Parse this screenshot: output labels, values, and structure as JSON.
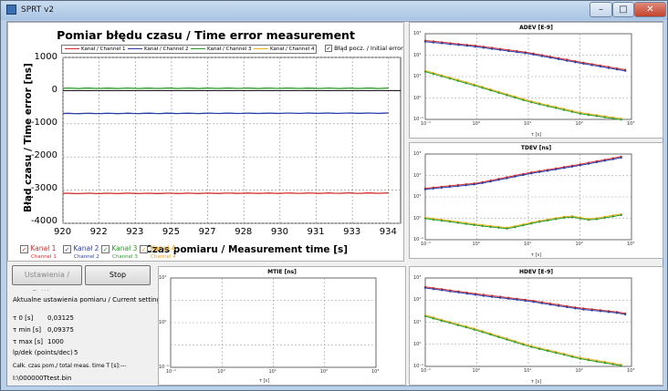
{
  "window": {
    "title": "SPRT v2",
    "min": "–",
    "max": "□",
    "close": "✕"
  },
  "colors": {
    "ch1": "#d03030",
    "ch2": "#2a3ea8",
    "ch3": "#2a9a2a",
    "ch4": "#e8b21e"
  },
  "main_chart": {
    "title": "Pomiar błędu czasu / Time error measurement",
    "ylabel": "Błąd czasu / Time error [ns]",
    "xlabel": "Czas pomiaru / Measurement time [s]",
    "yticks": [
      "1000",
      "0",
      "-1000",
      "-2000",
      "-3000",
      "-4000"
    ],
    "xticks": [
      "920",
      "922",
      "923",
      "925",
      "927",
      "928",
      "930",
      "931",
      "933",
      "934"
    ],
    "legend": [
      "Kanał / Channel 1",
      "Kanał / Channel 2",
      "Kanał / Channel 3",
      "Kanał / Channel 4"
    ],
    "initial_error_label": "Błąd pocz. / Initial error"
  },
  "chart_data": [
    {
      "type": "line",
      "title": "Pomiar błędu czasu / Time error measurement",
      "xlabel": "Czas pomiaru / Measurement time [s]",
      "ylabel": "Błąd czasu / Time error [ns]",
      "xlim": [
        920,
        934
      ],
      "ylim": [
        -4000,
        1000
      ],
      "grid": true,
      "series": [
        {
          "name": "Kanał / Channel 1",
          "x": [
            920,
            934
          ],
          "y": [
            -3100,
            -3090
          ]
        },
        {
          "name": "Kanał / Channel 2",
          "x": [
            920,
            934
          ],
          "y": [
            -690,
            -680
          ]
        },
        {
          "name": "Kanał / Channel 3",
          "x": [
            920,
            934
          ],
          "y": [
            70,
            70
          ]
        }
      ]
    },
    {
      "type": "line",
      "title": "ADEV [E-9]",
      "scale": "log-log",
      "xlabel": "τ [s]"
    },
    {
      "type": "line",
      "title": "TDEV [ns]",
      "scale": "log-log",
      "xlabel": "τ [s]"
    },
    {
      "type": "line",
      "title": "MTIE [ns]",
      "scale": "log-log",
      "xlabel": "τ [s]"
    },
    {
      "type": "line",
      "title": "HDEV [E-9]",
      "scale": "log-log",
      "xlabel": "τ [s]"
    }
  ],
  "small_charts": {
    "adev": {
      "title": "ADEV [E-9]",
      "xlabel": "τ [s]"
    },
    "tdev": {
      "title": "TDEV [ns]",
      "xlabel": "τ [s]"
    },
    "mtie": {
      "title": "MTIE [ns]",
      "xlabel": "τ [s]"
    },
    "hdev": {
      "title": "HDEV [E-9]",
      "xlabel": "τ [s]"
    }
  },
  "channels": [
    {
      "label": "Kanał 1",
      "sub": "Channel 1",
      "checked": "✓"
    },
    {
      "label": "Kanał 2",
      "sub": "Channel 2",
      "checked": "✓"
    },
    {
      "label": "Kanał 3",
      "sub": "Channel 3",
      "checked": "✓"
    },
    {
      "label": "Kanał 4",
      "sub": "Channel 4",
      "checked": "✓"
    }
  ],
  "buttons": {
    "settings": "Ustawienia / Settings",
    "stop": "Stop"
  },
  "settings": {
    "title": "Aktualne ustawienia pomiaru / Current settings",
    "tau0_label": "τ 0 [s]",
    "tau0": "0,03125",
    "taumin_label": "τ min [s]",
    "taumin": "0,09375",
    "taumax_label": "τ max [s]",
    "taumax": "1000",
    "ppd_label": "lp/dek (points/dec)",
    "ppd": "5",
    "total_label": "Całk. czas pom./ total meas. time T [s]:",
    "total": "---",
    "file": "I:\\000000Ttest.bin"
  }
}
